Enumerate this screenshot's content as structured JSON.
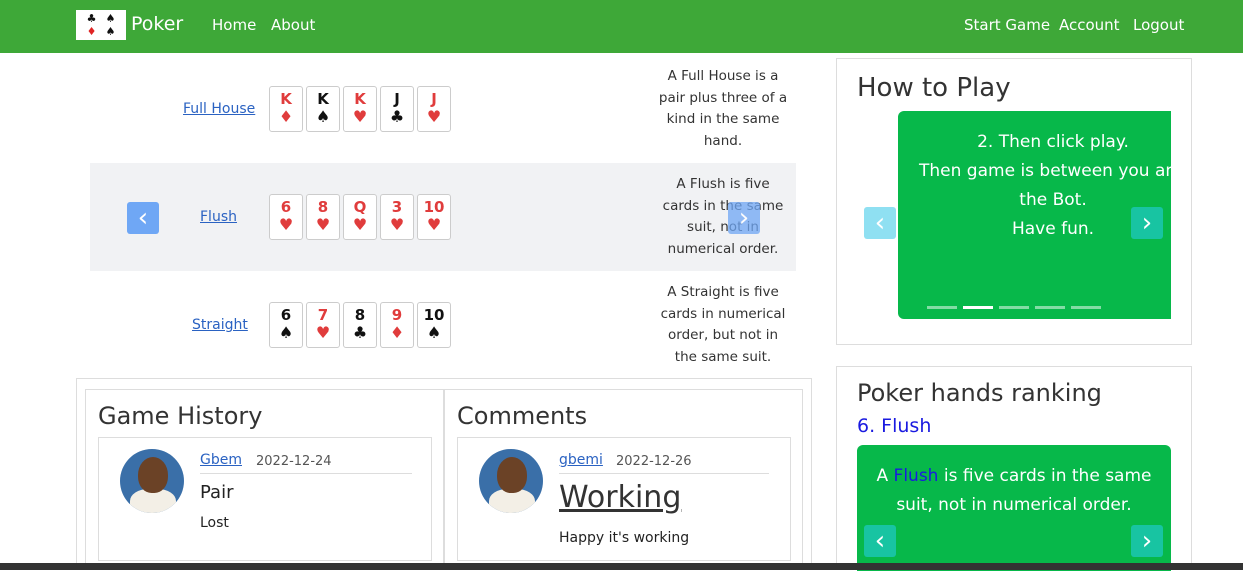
{
  "nav": {
    "brand": "Poker",
    "home": "Home",
    "about": "About",
    "start_game": "Start Game",
    "account": "Account",
    "logout": "Logout",
    "logo_suits": [
      "♣",
      "♠",
      "♦",
      "♠"
    ]
  },
  "hands": [
    {
      "name": "Full House",
      "cards": [
        {
          "rank": "K",
          "suit": "♦",
          "color": "red"
        },
        {
          "rank": "K",
          "suit": "♠",
          "color": "black"
        },
        {
          "rank": "K",
          "suit": "♥",
          "color": "red"
        },
        {
          "rank": "J",
          "suit": "♣",
          "color": "black"
        },
        {
          "rank": "J",
          "suit": "♥",
          "color": "red"
        }
      ],
      "desc": "A Full House is a pair plus three of a kind in the same hand."
    },
    {
      "name": "Flush",
      "cards": [
        {
          "rank": "6",
          "suit": "♥",
          "color": "red"
        },
        {
          "rank": "8",
          "suit": "♥",
          "color": "red"
        },
        {
          "rank": "Q",
          "suit": "♥",
          "color": "red"
        },
        {
          "rank": "3",
          "suit": "♥",
          "color": "red"
        },
        {
          "rank": "10",
          "suit": "♥",
          "color": "red"
        }
      ],
      "desc": "A Flush is five cards in the same suit, not in numerical order."
    },
    {
      "name": "Straight",
      "cards": [
        {
          "rank": "6",
          "suit": "♠",
          "color": "black"
        },
        {
          "rank": "7",
          "suit": "♥",
          "color": "red"
        },
        {
          "rank": "8",
          "suit": "♣",
          "color": "black"
        },
        {
          "rank": "9",
          "suit": "♦",
          "color": "red"
        },
        {
          "rank": "10",
          "suit": "♠",
          "color": "black"
        }
      ],
      "desc": "A Straight is five cards in numerical order, but not in the same suit."
    }
  ],
  "controls": {
    "prev": "‹",
    "next": "›"
  },
  "game_history": {
    "title": "Game History",
    "entry": {
      "user": "Gbem",
      "date": "2022-12-24",
      "heading": "Pair",
      "result": "Lost"
    }
  },
  "comments": {
    "title": "Comments",
    "entry": {
      "user": "gbemi",
      "date": "2022-12-26",
      "heading": "Working",
      "body": "Happy it's working"
    }
  },
  "how_to_play": {
    "title": "How to Play",
    "slide_lines": [
      "2. Then click play.",
      "Then game is between you and",
      "the Bot.",
      "Have fun."
    ],
    "indicator_count": 5,
    "active_indicator": 1
  },
  "ranking": {
    "title": "Poker hands ranking",
    "item": "6. Flush",
    "slide_pre": "A ",
    "slide_link": "Flush",
    "slide_post": " is five cards in the same",
    "slide_line2": "suit, not in numerical order."
  },
  "colors": {
    "navbar": "#3ea838",
    "slide_green": "#07b84a",
    "link": "#2a62c2"
  }
}
